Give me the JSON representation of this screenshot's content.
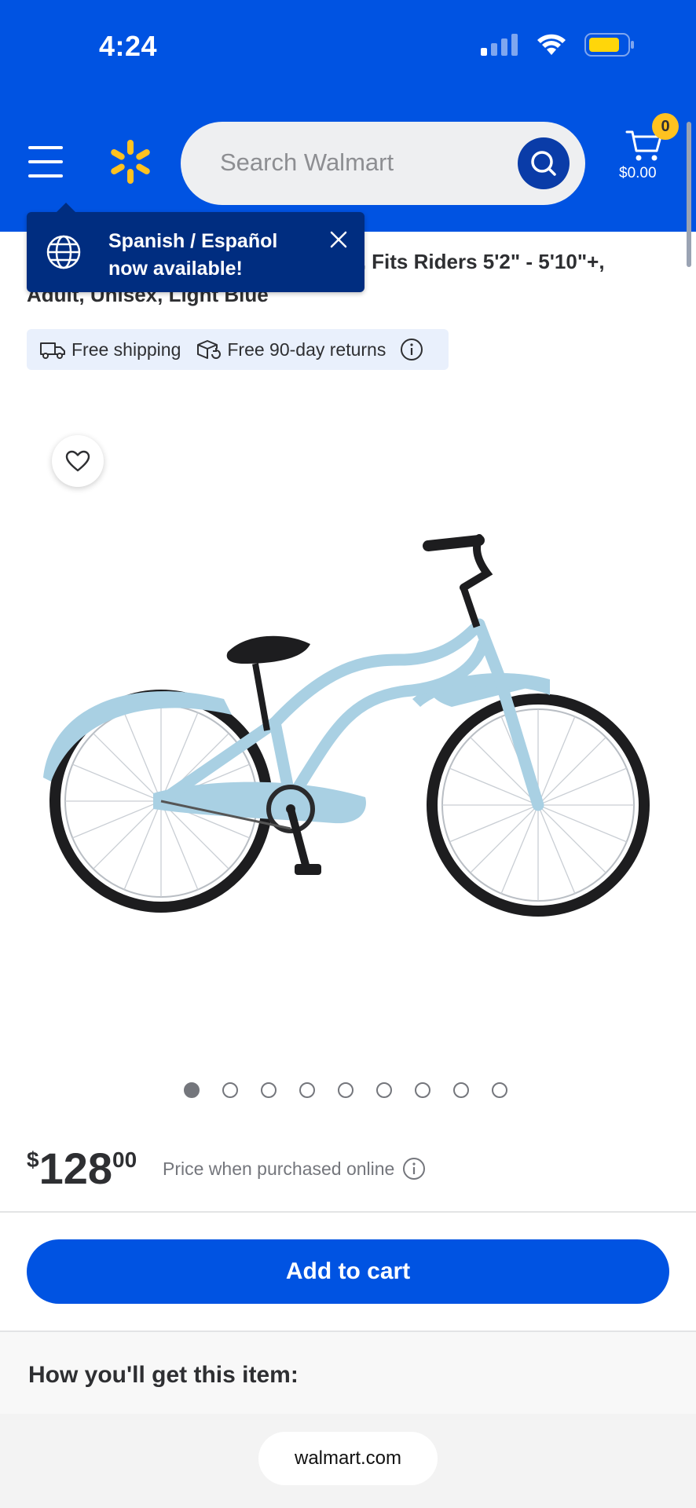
{
  "status_bar": {
    "time": "4:24"
  },
  "header": {
    "search_placeholder": "Search Walmart",
    "cart_count": "0",
    "cart_total": "$0.00",
    "brand_color": "#0053e2",
    "accent_color": "#ffc220"
  },
  "tooltip": {
    "line1": "Spanish / Español",
    "line2": "now available!"
  },
  "product": {
    "title": "Concord Women's Cruiser Bicycle, Fits Riders 5'2\" - 5'10\"+, Adult, Unisex, Light Blue",
    "shipping_label": "Free shipping",
    "returns_label": "Free 90-day returns",
    "price_currency": "$",
    "price_whole": "128",
    "price_cents": "00",
    "price_note": "Price when purchased online",
    "image_count": 9,
    "active_image": 1
  },
  "actions": {
    "add_to_cart": "Add to cart"
  },
  "fulfillment": {
    "title": "How you'll get this item:"
  },
  "browser": {
    "url": "walmart.com"
  },
  "icons": [
    "menu-icon",
    "spark-logo-icon",
    "search-icon",
    "cart-icon",
    "globe-icon",
    "close-icon",
    "truck-icon",
    "return-box-icon",
    "info-icon",
    "heart-icon"
  ]
}
